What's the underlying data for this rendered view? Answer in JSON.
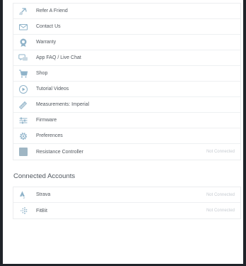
{
  "settings": {
    "items": [
      {
        "label": "Refer A Friend",
        "icon": "referral-icon",
        "status": ""
      },
      {
        "label": "Contact Us",
        "icon": "envelope-icon",
        "status": ""
      },
      {
        "label": "Warranty",
        "icon": "warranty-badge-icon",
        "status": ""
      },
      {
        "label": "App FAQ / Live Chat",
        "icon": "chat-bubbles-icon",
        "status": ""
      },
      {
        "label": "Shop",
        "icon": "cart-icon",
        "status": ""
      },
      {
        "label": "Tutorial Videos",
        "icon": "play-circle-icon",
        "status": ""
      },
      {
        "label": "Measurements: Imperial",
        "icon": "ruler-icon",
        "status": ""
      },
      {
        "label": "Firmware",
        "icon": "firmware-icon",
        "status": ""
      },
      {
        "label": "Preferences",
        "icon": "gear-icon",
        "status": ""
      },
      {
        "label": "Resistance Controller",
        "icon": "resistance-controller-icon",
        "status": "Not Connected"
      }
    ]
  },
  "connected_accounts": {
    "title": "Connected Accounts",
    "items": [
      {
        "label": "Strava",
        "icon": "strava-icon",
        "status": "Not Connected"
      },
      {
        "label": "FitBit",
        "icon": "fitbit-icon",
        "status": "Not Connected"
      }
    ]
  },
  "colors": {
    "icon_blue": "#8fb3c9",
    "label_text": "#52585f",
    "status_text": "#c6cbd1",
    "frame": "#1f2329"
  }
}
